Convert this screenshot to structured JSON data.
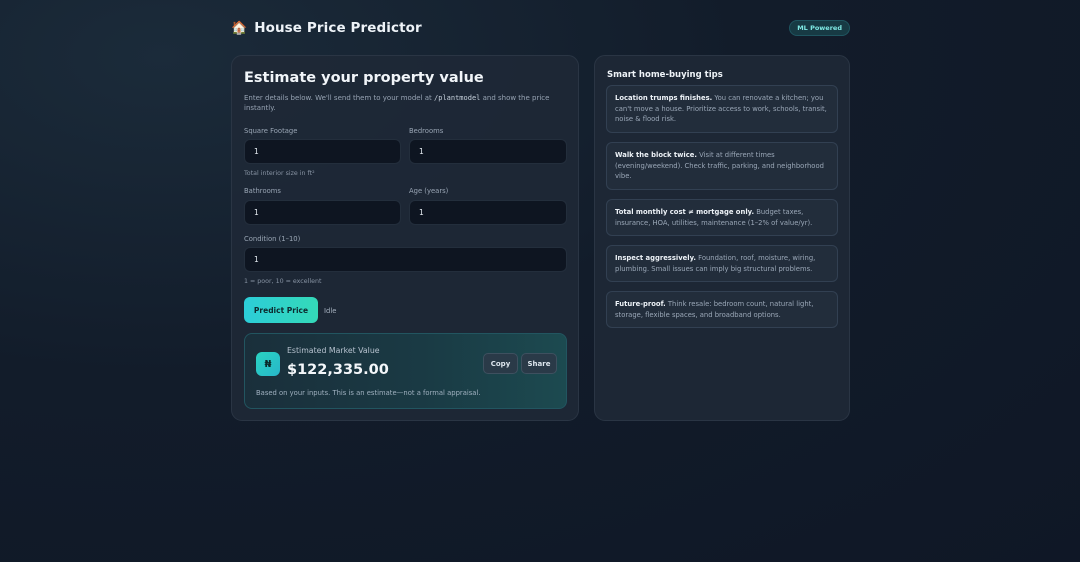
{
  "header": {
    "logo_glyph": "🏠",
    "title": "House Price Predictor",
    "badge": "ML Powered"
  },
  "form": {
    "title": "Estimate your property value",
    "intro_before": "Enter details below. We'll send them to your model at ",
    "intro_code": "/plantmodel",
    "intro_after": " and show the price instantly.",
    "fields": {
      "square_footage": {
        "label": "Square Footage",
        "value": "1",
        "hint": "Total interior size in ft²"
      },
      "bedrooms": {
        "label": "Bedrooms",
        "value": "1"
      },
      "bathrooms": {
        "label": "Bathrooms",
        "value": "1"
      },
      "age": {
        "label": "Age (years)",
        "value": "1"
      },
      "condition": {
        "label": "Condition (1–10)",
        "value": "1",
        "hint": "1 = poor, 10 = excellent"
      }
    },
    "predict_label": "Predict Price",
    "status": "Idle"
  },
  "result": {
    "icon_glyph": "₦",
    "label": "Estimated Market Value",
    "value": "$122,335.00",
    "note": "Based on your inputs. This is an estimate—not a formal appraisal.",
    "copy_label": "Copy",
    "share_label": "Share"
  },
  "tips": {
    "title": "Smart home-buying tips",
    "items": [
      {
        "title": "Location trumps finishes.",
        "text": " You can renovate a kitchen; you can't move a house. Prioritize access to work, schools, transit, noise & flood risk."
      },
      {
        "title": "Walk the block twice.",
        "text": " Visit at different times (evening/weekend). Check traffic, parking, and neighborhood vibe."
      },
      {
        "title": "Total monthly cost ≠ mortgage only.",
        "text": " Budget taxes, insurance, HOA, utilities, maintenance (1–2% of value/yr)."
      },
      {
        "title": "Inspect aggressively.",
        "text": " Foundation, roof, moisture, wiring, plumbing. Small issues can imply big structural problems."
      },
      {
        "title": "Future-proof.",
        "text": " Think resale: bedroom count, natural light, storage, flexible spaces, and broadband options."
      }
    ]
  },
  "colors": {
    "accent": "#2ccdd8",
    "accent_2": "#34d9b8",
    "background": "#0f1726",
    "card": "#1e2836"
  }
}
